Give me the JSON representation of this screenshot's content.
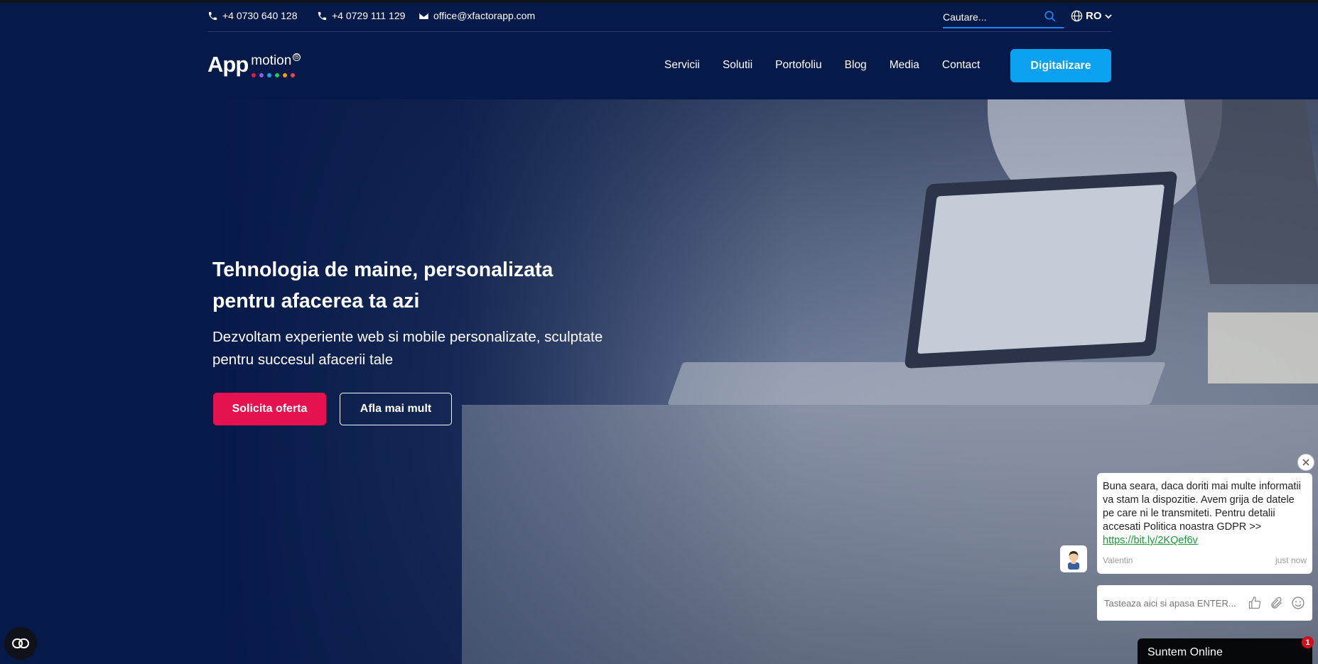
{
  "topbar": {
    "phone1": "+4 0730 640 128",
    "phone2": "+4 0729 111 129",
    "email": "office@xfactorapp.com",
    "search_placeholder": "Cautare...",
    "language": "RO"
  },
  "header": {
    "logo_main": "App",
    "logo_sub": "motion",
    "logo_reg": "®",
    "logo_dot_colors": [
      "#e11d48",
      "#8b5cf6",
      "#0ea5e9",
      "#22c55e",
      "#f59e0b",
      "#ef4444"
    ],
    "nav": [
      "Servicii",
      "Solutii",
      "Portofoliu",
      "Blog",
      "Media",
      "Contact"
    ],
    "cta_label": "Digitalizare"
  },
  "hero": {
    "title": "Tehnologia de maine, personalizata pentru afacerea ta azi",
    "subtitle": "Dezvoltam experiente web si mobile personalizate, sculptate pentru succesul afacerii tale",
    "primary_button": "Solicita oferta",
    "secondary_button": "Afla mai mult"
  },
  "chat": {
    "message": "Buna seara, daca doriti mai multe informatii va stam la dispozitie. Avem grija de datele pe care ni le transmiteti. Pentru detalii accesati Politica noastra GDPR >> ",
    "link": "https://bit.ly/2KQef6v",
    "agent": "Valentin",
    "time": "just now",
    "input_placeholder": "Tasteaza aici si apasa ENTER...",
    "status_label": "Suntem Online",
    "unread_count": "1"
  },
  "colors": {
    "background": "#061a4a",
    "accent_blue": "#0aa1f1",
    "accent_red": "#e5124f",
    "link_green": "#1b9a3a"
  },
  "icons": {
    "phone": "phone-icon",
    "email": "envelope-icon",
    "search": "search-icon",
    "language": "globe-icon",
    "chevron": "chevron-down-icon",
    "consent": "cookie-consent-icon",
    "close": "close-icon",
    "like": "thumbs-up-icon",
    "attach": "paperclip-icon",
    "emoji": "smiley-icon"
  }
}
